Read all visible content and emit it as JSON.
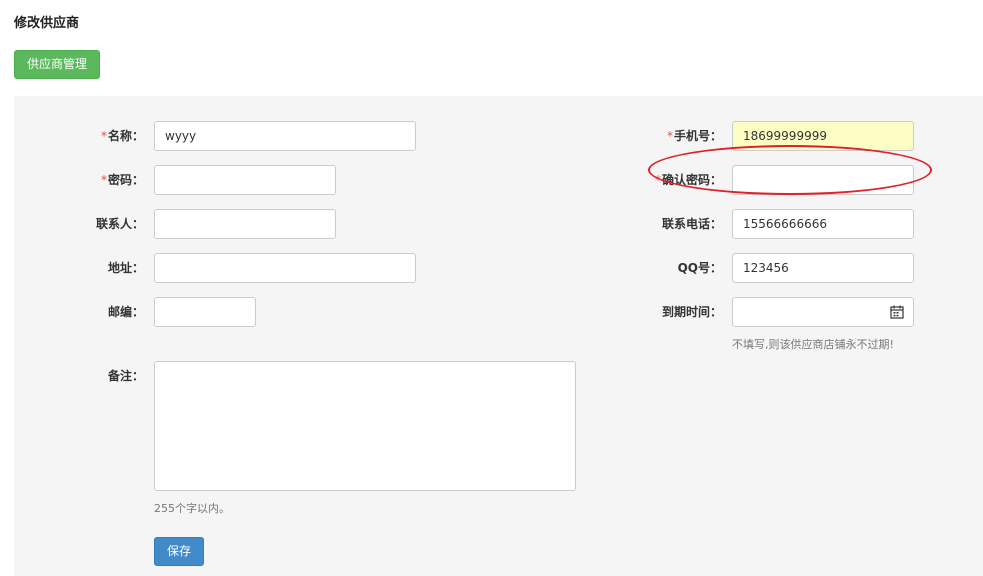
{
  "header": {
    "title": "修改供应商",
    "manage_button": "供应商管理"
  },
  "form": {
    "name": {
      "label": "名称：",
      "required_mark": "*",
      "value": "wyyy"
    },
    "password": {
      "label": "密码：",
      "required_mark": "*",
      "value": ""
    },
    "contact": {
      "label": "联系人：",
      "value": ""
    },
    "address": {
      "label": "地址：",
      "value": ""
    },
    "postcode": {
      "label": "邮编：",
      "value": ""
    },
    "remark": {
      "label": "备注：",
      "value": "",
      "help": "255个字以内。"
    },
    "phone": {
      "label": "手机号：",
      "required_mark": "*",
      "value": "18699999999"
    },
    "confirm_password": {
      "label": "确认密码：",
      "required_mark": "*",
      "value": ""
    },
    "contact_phone": {
      "label": "联系电话：",
      "value": "15566666666"
    },
    "qq": {
      "label": "QQ号：",
      "value": "123456"
    },
    "expire": {
      "label": "到期时间：",
      "value": "",
      "help": "不填写,则该供应商店铺永不过期!",
      "icon": "calendar-icon"
    },
    "save_button": "保存"
  },
  "colors": {
    "manage_button": "#5cb85c",
    "save_button": "#428bca",
    "required": "#d9534f",
    "highlight_field": "#fcfdc3",
    "annotation": "#e0202a",
    "panel": "#f5f5f5"
  }
}
